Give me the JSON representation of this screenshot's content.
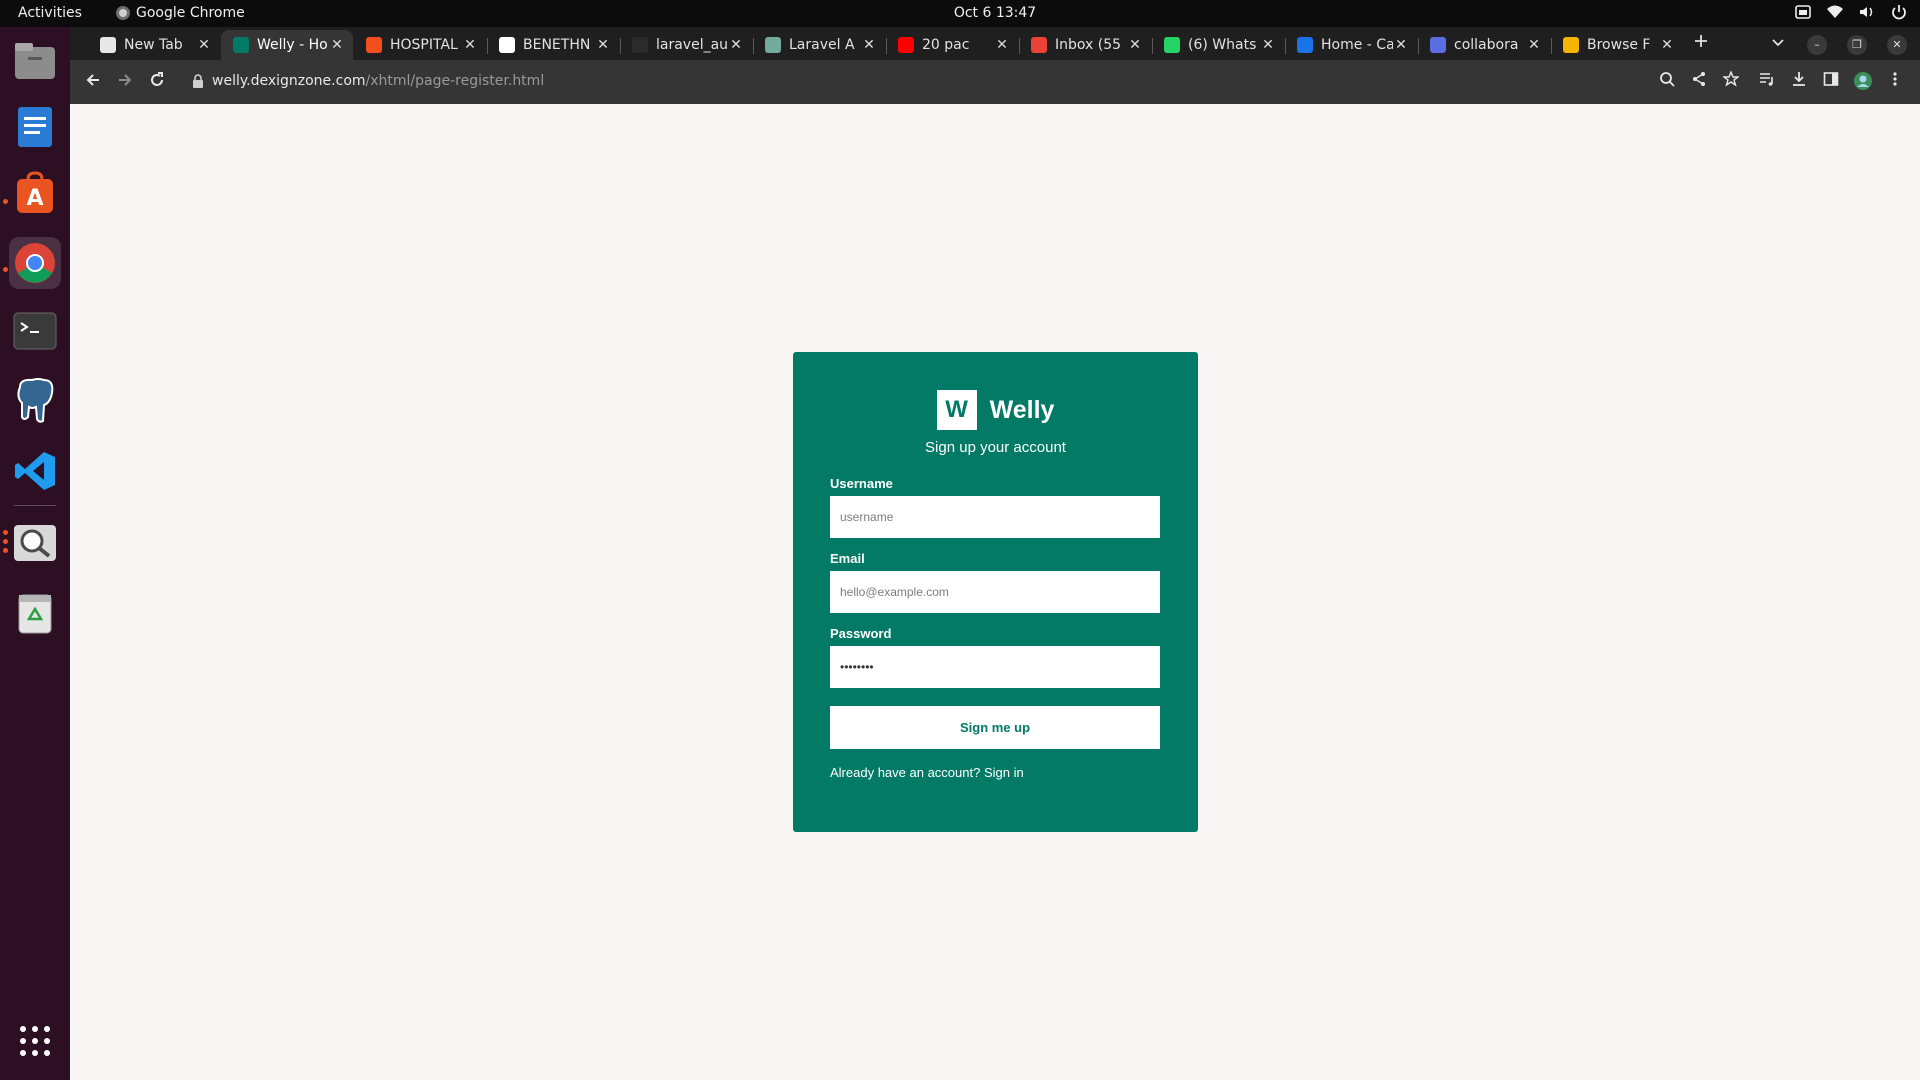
{
  "system": {
    "activities": "Activities",
    "app_name": "Google Chrome",
    "clock": "Oct 6  13:47"
  },
  "dock": {
    "items": [
      {
        "name": "files",
        "icon": "files-icon"
      },
      {
        "name": "libreoffice-writer",
        "icon": "writer-icon"
      },
      {
        "name": "ubuntu-software",
        "icon": "software-center-icon"
      },
      {
        "name": "google-chrome",
        "icon": "chrome-icon",
        "active": true
      },
      {
        "name": "terminal",
        "icon": "terminal-icon"
      },
      {
        "name": "pgadmin",
        "icon": "postgres-elephant-icon"
      },
      {
        "name": "vscode",
        "icon": "vscode-icon"
      },
      {
        "name": "image-viewer",
        "icon": "magnifier-icon"
      },
      {
        "name": "trash",
        "icon": "trash-icon"
      },
      {
        "name": "show-apps",
        "icon": "app-grid-icon"
      }
    ]
  },
  "tabs": [
    {
      "title": "New Tab",
      "favicon_color": "#e8e8e8"
    },
    {
      "title": "Welly - Ho",
      "favicon_color": "#027a65",
      "active": true
    },
    {
      "title": "HOSPITAL",
      "favicon_color": "#f24e1e"
    },
    {
      "title": "BENETHN",
      "favicon_color": "#ffffff"
    },
    {
      "title": "laravel_au",
      "favicon_color": "#2b2b2b"
    },
    {
      "title": "Laravel A",
      "favicon_color": "#74aa9c"
    },
    {
      "title": "20 pac",
      "favicon_color": "#ff0000"
    },
    {
      "title": "Inbox (55",
      "favicon_color": "#ea4335"
    },
    {
      "title": "(6) Whats",
      "favicon_color": "#25d366"
    },
    {
      "title": "Home - Ca",
      "favicon_color": "#1a73e8"
    },
    {
      "title": "collabora",
      "favicon_color": "#5b6ee1"
    },
    {
      "title": "Browse F",
      "favicon_color": "#f4b400"
    }
  ],
  "address_bar": {
    "domain": "welly.dexignzone.com",
    "path": "/xhtml/page-register.html"
  },
  "page": {
    "brand_letter": "W",
    "brand_name": "Welly",
    "heading": "Sign up your account",
    "form": {
      "username_label": "Username",
      "username_placeholder": "username",
      "email_label": "Email",
      "email_placeholder": "hello@example.com",
      "password_label": "Password",
      "password_value": "password",
      "submit_label": "Sign me up"
    },
    "signin_prompt": "Already have an account?",
    "signin_link": "Sign in"
  },
  "colors": {
    "brand": "#027a65",
    "page_bg": "#f8f7f5",
    "dock_bg": "#2c0f23",
    "chrome_bg": "#1f1f1f"
  }
}
